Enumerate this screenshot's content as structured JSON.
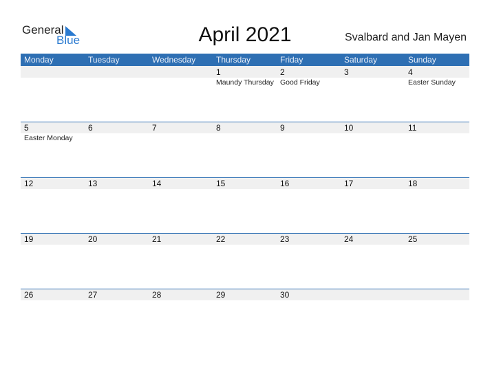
{
  "logo": {
    "general": "General",
    "blue": "Blue"
  },
  "title": "April 2021",
  "region": "Svalbard and Jan Mayen",
  "weekdays": [
    "Monday",
    "Tuesday",
    "Wednesday",
    "Thursday",
    "Friday",
    "Saturday",
    "Sunday"
  ],
  "weeks": [
    [
      {
        "day": ""
      },
      {
        "day": ""
      },
      {
        "day": ""
      },
      {
        "day": "1",
        "holiday": "Maundy Thursday"
      },
      {
        "day": "2",
        "holiday": "Good Friday"
      },
      {
        "day": "3"
      },
      {
        "day": "4",
        "holiday": "Easter Sunday"
      }
    ],
    [
      {
        "day": "5",
        "holiday": "Easter Monday"
      },
      {
        "day": "6"
      },
      {
        "day": "7"
      },
      {
        "day": "8"
      },
      {
        "day": "9"
      },
      {
        "day": "10"
      },
      {
        "day": "11"
      }
    ],
    [
      {
        "day": "12"
      },
      {
        "day": "13"
      },
      {
        "day": "14"
      },
      {
        "day": "15"
      },
      {
        "day": "16"
      },
      {
        "day": "17"
      },
      {
        "day": "18"
      }
    ],
    [
      {
        "day": "19"
      },
      {
        "day": "20"
      },
      {
        "day": "21"
      },
      {
        "day": "22"
      },
      {
        "day": "23"
      },
      {
        "day": "24"
      },
      {
        "day": "25"
      }
    ],
    [
      {
        "day": "26"
      },
      {
        "day": "27"
      },
      {
        "day": "28"
      },
      {
        "day": "29"
      },
      {
        "day": "30"
      },
      {
        "day": ""
      },
      {
        "day": ""
      }
    ]
  ],
  "colors": {
    "accent": "#2e6fb3",
    "band": "#f0f0f0",
    "logo_blue": "#2a7ad0"
  }
}
